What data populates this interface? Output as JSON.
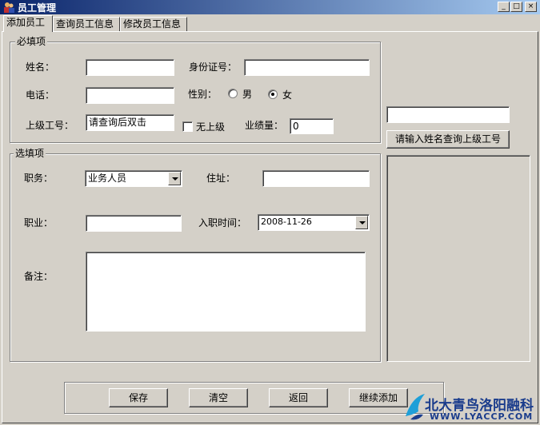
{
  "window": {
    "title": "员工管理",
    "controls": {
      "minimize": "_",
      "maximize": "□",
      "close": "×"
    }
  },
  "tabs": [
    {
      "label": "添加员工",
      "active": true
    },
    {
      "label": "查询员工信息",
      "active": false
    },
    {
      "label": "修改员工信息",
      "active": false
    }
  ],
  "required": {
    "title": "必填项",
    "name_label": "姓名：",
    "name_value": "",
    "id_label": "身份证号：",
    "id_value": "",
    "phone_label": "电话：",
    "phone_value": "",
    "gender_label": "性别：",
    "gender_options": [
      "男",
      "女"
    ],
    "gender_selected": "女",
    "superior_label": "上级工号：",
    "superior_value": "请查询后双击",
    "no_superior_label": "无上级",
    "no_superior_checked": false,
    "performance_label": "业绩量：",
    "performance_value": "0"
  },
  "optional": {
    "title": "选填项",
    "position_label": "职务：",
    "position_value": "业务人员",
    "address_label": "住址：",
    "address_value": "",
    "occupation_label": "职业：",
    "occupation_value": "",
    "hire_date_label": "入职时间：",
    "hire_date_value": "2008-11-26",
    "remarks_label": "备注：",
    "remarks_value": ""
  },
  "search": {
    "input_value": "",
    "button_label": "请输入姓名查询上级工号"
  },
  "actions": {
    "save": "保存",
    "clear": "清空",
    "back": "返回",
    "continue_add": "继续添加"
  },
  "watermark": {
    "text_cn": "北大青鸟洛阳融科",
    "text_en": "WWW.LYACCP.COM"
  },
  "colors": {
    "titlebar_start": "#0a246a",
    "titlebar_end": "#a6caf0",
    "window_face": "#d4d0c8",
    "watermark": "#1a3c8c"
  }
}
